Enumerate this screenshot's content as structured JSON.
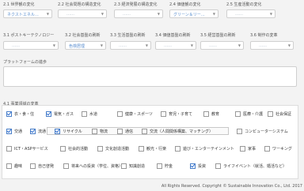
{
  "row1": {
    "labels": [
      "2.1 世界観の変化",
      "2.2 社会問題の構造変化",
      "2.3 経済発展の構造変化",
      "2.4 価値観の変化",
      "2.5 生産活動の変化"
    ],
    "values": [
      "ネクストエネル…",
      "……",
      "……",
      "グリーン＆リー…",
      "……"
    ]
  },
  "row2": {
    "labels": [
      "3.1 ポストキーテクノロジー",
      "3.2 社会基盤の刷新",
      "3.3 生活基盤の刷新",
      "3.4 価値基盤の刷新",
      "3.5 経営基盤の刷新",
      "3.6 制作の変革"
    ],
    "values": [
      "……",
      "色検居理",
      "……",
      "……",
      "……",
      "……"
    ]
  },
  "platform_label": "プラットフォームの進歩",
  "industry_label": "4.1 事業領域の変革",
  "checkboxes": [
    {
      "label": "衣・食・住",
      "checked": true
    },
    {
      "label": "電気・ガス",
      "checked": true
    },
    {
      "label": "水道",
      "checked": false
    },
    {
      "label": "健康・スポーツ",
      "checked": false
    },
    {
      "label": "育児・子育て",
      "checked": false
    },
    {
      "label": "教育",
      "checked": false
    },
    {
      "label": "医療・介護",
      "checked": false
    },
    {
      "label": "社会保証",
      "checked": false
    },
    {
      "label": "交通",
      "checked": true
    },
    {
      "label": "流通",
      "checked": true
    },
    {
      "label": "リサイクル",
      "checked": true
    },
    {
      "label": "物流",
      "checked": false
    },
    {
      "label": "通信",
      "checked": false
    },
    {
      "label": "交流（人間関係構築、マッチング）",
      "checked": false
    },
    {
      "label": "コンピューターシステム",
      "checked": false
    },
    {
      "label": "ICT・ASPサービス",
      "checked": false
    },
    {
      "label": "社会的活動",
      "checked": false
    },
    {
      "label": "文化創造活動",
      "checked": false
    },
    {
      "label": "観光・行楽",
      "checked": false
    },
    {
      "label": "遊び・エンターテインメント",
      "checked": false
    },
    {
      "label": "家事",
      "checked": false
    },
    {
      "label": "ワーキング",
      "checked": false
    },
    {
      "label": "趣味",
      "checked": false
    },
    {
      "label": "自己啓発",
      "checked": false
    },
    {
      "label": "将来への投資（学位、資格）",
      "checked": false
    },
    {
      "label": "知識創造",
      "checked": false
    },
    {
      "label": "貯金",
      "checked": false
    },
    {
      "label": "投資",
      "checked": true
    },
    {
      "label": "ライフイベント（就活、婚活など）",
      "checked": false
    }
  ],
  "footer": "All Rights Reserved. Copyright  © Sustainable Innovation Co., Ltd.  2017"
}
